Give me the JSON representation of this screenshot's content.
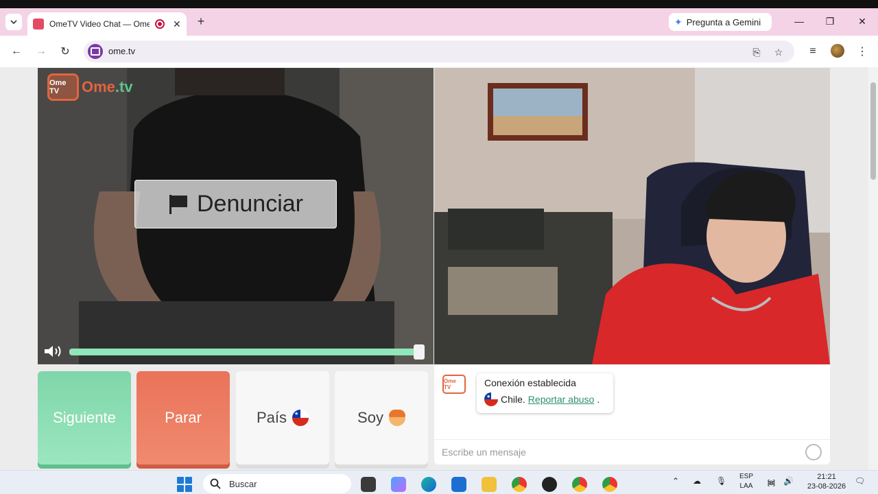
{
  "browser": {
    "tab_title": "OmeTV Video Chat — Ome",
    "new_tab": "+",
    "gemini_label": "Pregunta a Gemini",
    "url": "ome.tv",
    "min": "—",
    "restore": "❐",
    "close": "✕"
  },
  "page": {
    "logo": {
      "badge": "Ome TV",
      "brand_a": "Ome",
      "brand_b": ".tv"
    },
    "report_button": "Denunciar",
    "volume_level": 1.0,
    "buttons": {
      "next": "Siguiente",
      "stop": "Parar",
      "country": "País",
      "gender": "Soy"
    },
    "chat": {
      "logo_text": "Ome TV",
      "status": "Conexión establecida",
      "country": "Chile.",
      "report_link": "Reportar abuso",
      "report_suffix": ".",
      "placeholder": "Escribe un mensaje"
    }
  },
  "taskbar": {
    "search_label": "Buscar",
    "lang_top": "ESP",
    "lang_bottom": "LAA",
    "time": "21:21",
    "date": "23-08-2026"
  },
  "colors": {
    "accent_green": "#7fd6a9",
    "accent_red": "#e9735a",
    "brand_orange": "#e2653f",
    "tab_strip": "#f5d3e7"
  },
  "icons": [
    "search-icon",
    "back-icon",
    "forward-icon",
    "reload-icon",
    "camera-icon",
    "install-icon",
    "bookmark-star-icon",
    "media-icon",
    "menu-dots-icon",
    "flag-icon",
    "speaker-icon",
    "chile-flag-icon",
    "boy-emoji-icon",
    "emoji-icon",
    "windows-start-icon"
  ]
}
